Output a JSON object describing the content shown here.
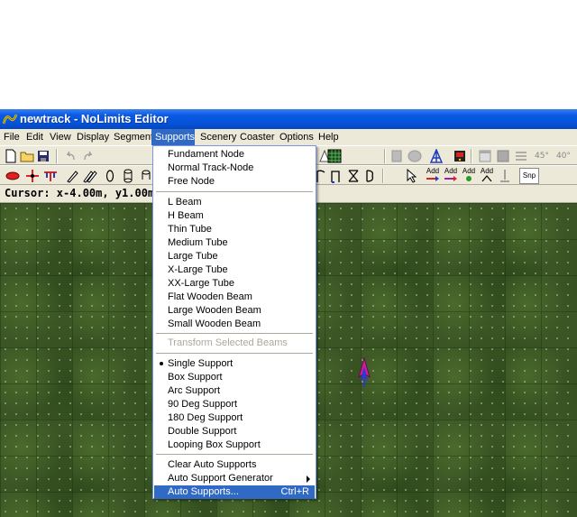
{
  "window": {
    "title": "newtrack - NoLimits Editor"
  },
  "menubar": [
    "File",
    "Edit",
    "View",
    "Display",
    "Segment",
    "Supports",
    "Scenery",
    "Coaster",
    "Options",
    "Help"
  ],
  "status": {
    "cursor": "Cursor: x-4.00m, y1.00m, z-3"
  },
  "toolbar": {
    "add_label": "Add",
    "snap_label": "Snp",
    "angle_45": "45°",
    "angle_40": "40°"
  },
  "supports_menu": {
    "items": [
      {
        "label": "Fundament Node"
      },
      {
        "label": "Normal Track-Node"
      },
      {
        "label": "Free Node"
      },
      {
        "label": "L Beam"
      },
      {
        "label": "H Beam"
      },
      {
        "label": "Thin Tube"
      },
      {
        "label": "Medium Tube"
      },
      {
        "label": "Large Tube"
      },
      {
        "label": "X-Large Tube"
      },
      {
        "label": "XX-Large Tube"
      },
      {
        "label": "Flat Wooden Beam"
      },
      {
        "label": "Large Wooden Beam"
      },
      {
        "label": "Small Wooden Beam"
      },
      {
        "label": "Transform Selected Beams"
      },
      {
        "label": "Single Support"
      },
      {
        "label": "Box Support"
      },
      {
        "label": "Arc Support"
      },
      {
        "label": "90 Deg Support"
      },
      {
        "label": "180 Deg Support"
      },
      {
        "label": "Double Support"
      },
      {
        "label": "Looping Box Support"
      },
      {
        "label": "Clear Auto Supports"
      },
      {
        "label": "Auto Support Generator"
      },
      {
        "label": "Auto Supports...",
        "shortcut": "Ctrl+R"
      }
    ]
  },
  "colors": {
    "menu_highlight": "#316ac5",
    "title_blue": "#0a5ae4",
    "grass": "#3b5524"
  }
}
